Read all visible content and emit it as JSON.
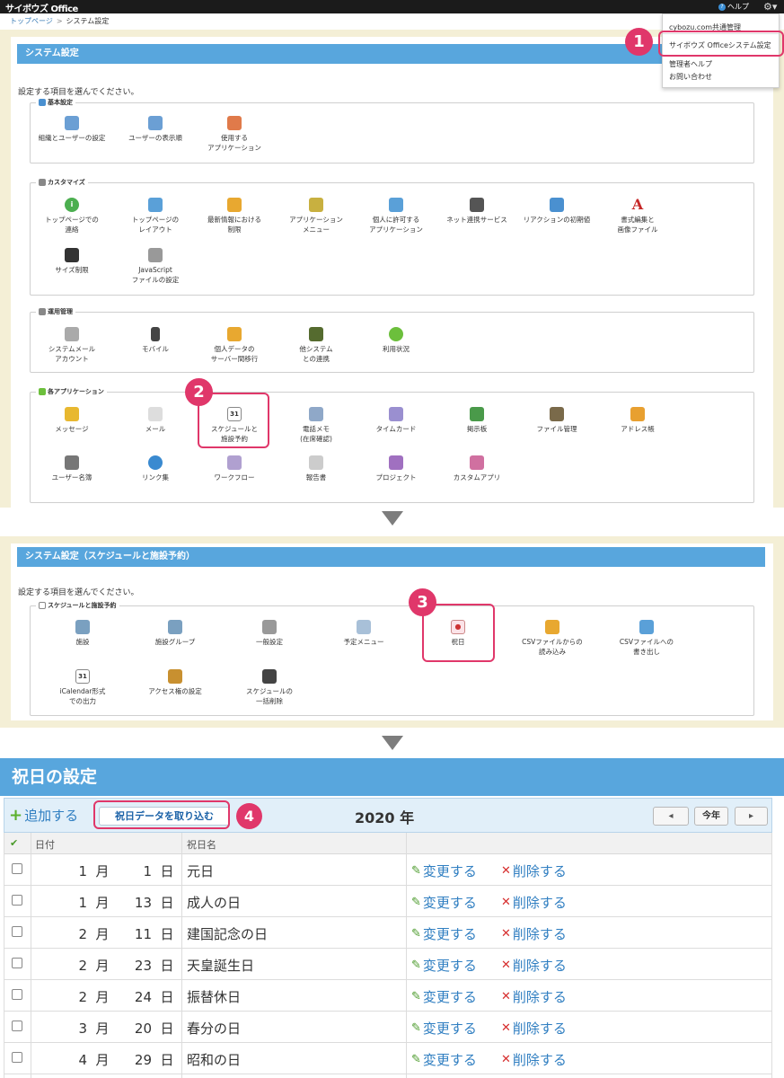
{
  "topbar": {
    "brand": "サイボウズ Office",
    "help": "ヘルプ"
  },
  "breadcrumb": {
    "home": "トップページ",
    "current": "システム設定"
  },
  "dropdown": {
    "items": [
      "cybozu.com共通管理",
      "サイボウズ Officeシステム設定",
      "管理者ヘルプ",
      "お問い合わせ"
    ]
  },
  "section1": {
    "title": "システム設定",
    "intro": "設定する項目を選んでください。",
    "groups": {
      "basic": {
        "label": "基本設定",
        "items": [
          "組織とユーザーの設定",
          "ユーザーの表示順",
          "使用する\nアプリケーション"
        ]
      },
      "customize": {
        "label": "カスタマイズ",
        "items": [
          "トップページでの\n連絡",
          "トップページの\nレイアウト",
          "最新情報における\n制限",
          "アプリケーション\nメニュー",
          "個人に許可する\nアプリケーション",
          "ネット連携サービス",
          "リアクションの初期値",
          "書式編集と\n画像ファイル",
          "サイズ制限",
          "JavaScript\nファイルの設定"
        ]
      },
      "ops": {
        "label": "運用管理",
        "items": [
          "システムメール\nアカウント",
          "モバイル",
          "個人データの\nサーバー間移行",
          "他システム\nとの連携",
          "利用状況"
        ]
      },
      "apps": {
        "label": "各アプリケーション",
        "items": [
          "メッセージ",
          "メール",
          "スケジュールと\n施設予約",
          "電話メモ\n(在席確認)",
          "タイムカード",
          "掲示板",
          "ファイル管理",
          "アドレス帳",
          "ユーザー名簿",
          "リンク集",
          "ワークフロー",
          "報告書",
          "プロジェクト",
          "カスタムアプリ"
        ]
      }
    }
  },
  "section2": {
    "title": "システム設定（スケジュールと施設予約）",
    "intro": "設定する項目を選んでください。",
    "group_label": "スケジュールと施設予約",
    "items": [
      "施設",
      "施設グループ",
      "一般設定",
      "予定メニュー",
      "祝日",
      "CSVファイルからの\n読み込み",
      "CSVファイルへの\n書き出し",
      "iCalendar形式\nでの出力",
      "アクセス権の設定",
      "スケジュールの\n一括削除"
    ]
  },
  "section3": {
    "title": "祝日の設定",
    "add_label": "追加する",
    "import_label": "祝日データを取り込む",
    "year": "2020 年",
    "prev": "◂",
    "today": "今年",
    "next": "▸",
    "col_date": "日付",
    "col_name": "祝日名",
    "edit_label": "変更する",
    "delete_label": "削除する",
    "month_unit": "月",
    "day_unit": "日",
    "rows": [
      {
        "month": "1",
        "day": "1",
        "name": "元日"
      },
      {
        "month": "1",
        "day": "13",
        "name": "成人の日"
      },
      {
        "month": "2",
        "day": "11",
        "name": "建国記念の日"
      },
      {
        "month": "2",
        "day": "23",
        "name": "天皇誕生日"
      },
      {
        "month": "2",
        "day": "24",
        "name": "振替休日"
      },
      {
        "month": "3",
        "day": "20",
        "name": "春分の日"
      },
      {
        "month": "4",
        "day": "29",
        "name": "昭和の日"
      }
    ]
  },
  "steps": [
    "1",
    "2",
    "3",
    "4"
  ]
}
